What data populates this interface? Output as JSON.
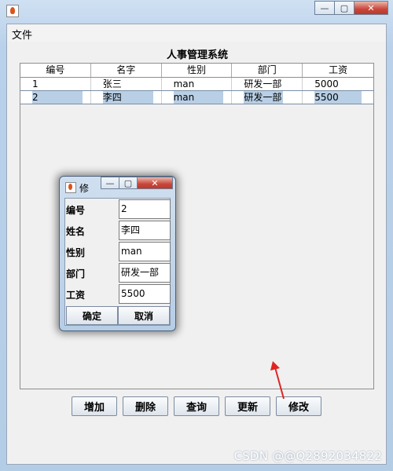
{
  "window": {
    "menu": {
      "file": "文件"
    },
    "title_text": "人事管理系统",
    "controls": {
      "minimize": "—",
      "maximize": "▢",
      "close": "✕"
    }
  },
  "table": {
    "headers": [
      "编号",
      "名字",
      "性别",
      "部门",
      "工资"
    ],
    "rows": [
      [
        "1",
        "张三",
        "man",
        "研发一部",
        "5000"
      ],
      [
        "2",
        "李四",
        "man",
        "研发一部",
        "5500"
      ]
    ],
    "selected_row": 1
  },
  "buttons": {
    "add": "增加",
    "delete": "删除",
    "query": "查询",
    "update": "更新",
    "modify": "修改"
  },
  "dialog": {
    "title": "修",
    "fields": [
      {
        "label": "编号",
        "value": "2"
      },
      {
        "label": "姓名",
        "value": "李四"
      },
      {
        "label": "性别",
        "value": "man"
      },
      {
        "label": "部门",
        "value": "研发一部"
      },
      {
        "label": "工资",
        "value": "5500"
      }
    ],
    "confirm": "确定",
    "cancel": "取消",
    "controls": {
      "minimize": "—",
      "maximize": "▢",
      "close": "✕"
    }
  },
  "watermark": "CSDN @@Q2892034822",
  "colors": {
    "titlebar": "#b9d1ea",
    "selection": "#b8cfe5",
    "arrow": "#e02424"
  }
}
